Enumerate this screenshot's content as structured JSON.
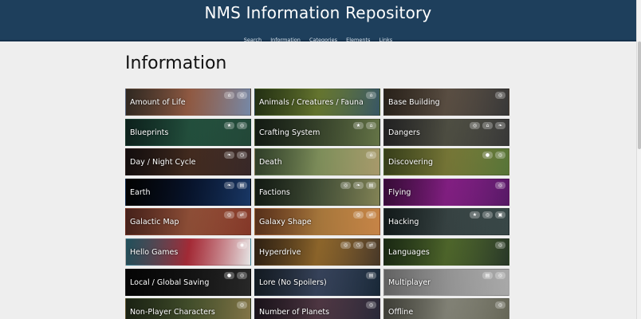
{
  "header": {
    "title": "NMS Information Repository",
    "nav": [
      "Search",
      "Information",
      "Categories",
      "Elements",
      "Links"
    ],
    "background": "#1e3f5c"
  },
  "page": {
    "heading": "Information"
  },
  "tiles": [
    {
      "label": "Amount of Life",
      "icons": [
        "tag-icon",
        "info-icon"
      ],
      "colors": [
        "#6b5a4a",
        "#c47a5a",
        "#7a8fb0"
      ]
    },
    {
      "label": "Animals / Creatures / Fauna",
      "icons": [
        "tag-icon"
      ],
      "colors": [
        "#4f6b2a",
        "#8aa040",
        "#3a5a6a"
      ]
    },
    {
      "label": "Base Building",
      "icons": [
        "info-icon"
      ],
      "colors": [
        "#5a4a3a",
        "#7a6a5a",
        "#3a3a3a"
      ]
    },
    {
      "label": "Blueprints",
      "icons": [
        "star-icon",
        "info-icon"
      ],
      "colors": [
        "#1d4a3f",
        "#2f6b52",
        "#244a3a"
      ]
    },
    {
      "label": "Crafting System",
      "icons": [
        "star-icon",
        "tag-icon"
      ],
      "colors": [
        "#2a3a2a",
        "#4a5a3a",
        "#6a7a4a"
      ]
    },
    {
      "label": "Dangers",
      "icons": [
        "info-icon",
        "tag-icon",
        "leaf-icon"
      ],
      "colors": [
        "#4a4a4a",
        "#6a6a5a",
        "#3a3a3a"
      ]
    },
    {
      "label": "Day / Night Cycle",
      "icons": [
        "leaf-icon",
        "clock-icon"
      ],
      "colors": [
        "#2a1e1e",
        "#5a3a2a",
        "#3a2a2a"
      ]
    },
    {
      "label": "Death",
      "icons": [
        "tag-icon"
      ],
      "colors": [
        "#6a8a5a",
        "#aac07a",
        "#b0a070"
      ]
    },
    {
      "label": "Discovering",
      "icons": [
        "pin-icon",
        "info-icon"
      ],
      "colors": [
        "#7a8a3a",
        "#a0a04a",
        "#5a7a3a"
      ]
    },
    {
      "label": "Earth",
      "icons": [
        "leaf-icon",
        "doc-icon"
      ],
      "colors": [
        "#050505",
        "#0a1a3a",
        "#1a3a6a"
      ]
    },
    {
      "label": "Factions",
      "icons": [
        "info-icon",
        "leaf-icon",
        "doc-icon"
      ],
      "colors": [
        "#2a3a2a",
        "#5a6a4a",
        "#8a8a5a"
      ]
    },
    {
      "label": "Flying",
      "icons": [
        "info-icon"
      ],
      "colors": [
        "#7a1a7a",
        "#b02ab0",
        "#5a1a6a"
      ]
    },
    {
      "label": "Galactic Map",
      "icons": [
        "info-icon",
        "link-icon"
      ],
      "colors": [
        "#9a4a3a",
        "#c06a4a",
        "#8a3a2a"
      ]
    },
    {
      "label": "Galaxy Shape",
      "icons": [
        "info-icon",
        "link-icon"
      ],
      "colors": [
        "#c06a3a",
        "#e0a050",
        "#d08a4a"
      ]
    },
    {
      "label": "Hacking",
      "icons": [
        "star-icon",
        "info-icon",
        "lock-icon"
      ],
      "colors": [
        "#2a3a3a",
        "#4a5a5a",
        "#3a4a4a"
      ]
    },
    {
      "label": "Hello Games",
      "icons": [
        "eye-icon"
      ],
      "colors": [
        "#4ab0c8",
        "#e03a4a",
        "#f0f0f0"
      ]
    },
    {
      "label": "Hyperdrive",
      "icons": [
        "info-icon",
        "clock-icon",
        "link-icon"
      ],
      "colors": [
        "#6a4a2a",
        "#c08a3a",
        "#4a3a2a"
      ]
    },
    {
      "label": "Languages",
      "icons": [
        "info-icon"
      ],
      "colors": [
        "#3a5a2a",
        "#6a8a3a",
        "#2a3a2a"
      ]
    },
    {
      "label": "Local / Global Saving",
      "icons": [
        "pin-icon",
        "info-icon"
      ],
      "colors": [
        "#0a0a0a",
        "#1a1a1a",
        "#2a2a2a"
      ]
    },
    {
      "label": "Lore (No Spoilers)",
      "icons": [
        "doc-icon"
      ],
      "colors": [
        "#2a3a4a",
        "#4a5a7a",
        "#1a2a3a"
      ]
    },
    {
      "label": "Multiplayer",
      "icons": [
        "doc-icon",
        "info-icon"
      ],
      "colors": [
        "#d8d8d8",
        "#c8c8c8",
        "#b0b0b0"
      ]
    },
    {
      "label": "Non-Player Characters",
      "icons": [
        "info-icon"
      ],
      "colors": [
        "#3a4a2a",
        "#5a6a3a",
        "#8a7a4a"
      ]
    },
    {
      "label": "Number of Planets",
      "icons": [
        "info-icon"
      ],
      "colors": [
        "#3a2a3a",
        "#6a4a5a",
        "#2a2a3a"
      ]
    },
    {
      "label": "Offline",
      "icons": [
        "info-icon"
      ],
      "colors": [
        "#8a8a7a",
        "#b0b0a0",
        "#6a6a5a"
      ]
    }
  ]
}
